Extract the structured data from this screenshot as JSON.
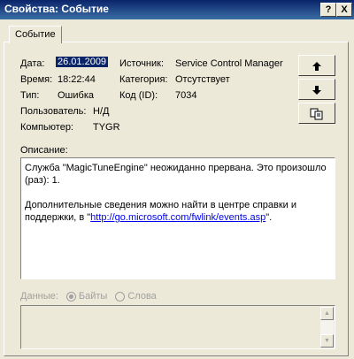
{
  "window": {
    "title": "Свойства: Событие",
    "help_glyph": "?",
    "close_glyph": "X"
  },
  "tab": {
    "label": "Событие"
  },
  "event": {
    "date_label": "Дата:",
    "date_value": "26.01.2009",
    "time_label": "Время:",
    "time_value": "18:22:44",
    "type_label": "Тип:",
    "type_value": "Ошибка",
    "user_label": "Пользователь:",
    "user_value": "Н/Д",
    "computer_label": "Компьютер:",
    "computer_value": "TYGR",
    "source_label": "Источник:",
    "source_value": "Service Control Manager",
    "category_label": "Категория:",
    "category_value": "Отсутствует",
    "id_label": "Код (ID):",
    "id_value": "7034"
  },
  "buttons": {
    "up_icon": "arrow-up-icon",
    "down_icon": "arrow-down-icon",
    "copy_icon": "copy-icon"
  },
  "description": {
    "label": "Описание:",
    "line1": "Служба \"MagicTuneEngine\" неожиданно прервана. Это произошло (раз): 1.",
    "line2_prefix": "Дополнительные сведения можно найти в центре справки и поддержки, в \"",
    "link": "http://go.microsoft.com/fwlink/events.asp",
    "line2_suffix": "\"."
  },
  "data_section": {
    "label": "Данные:",
    "option_bytes": "Байты",
    "option_words": "Слова",
    "selected": "Байты"
  }
}
